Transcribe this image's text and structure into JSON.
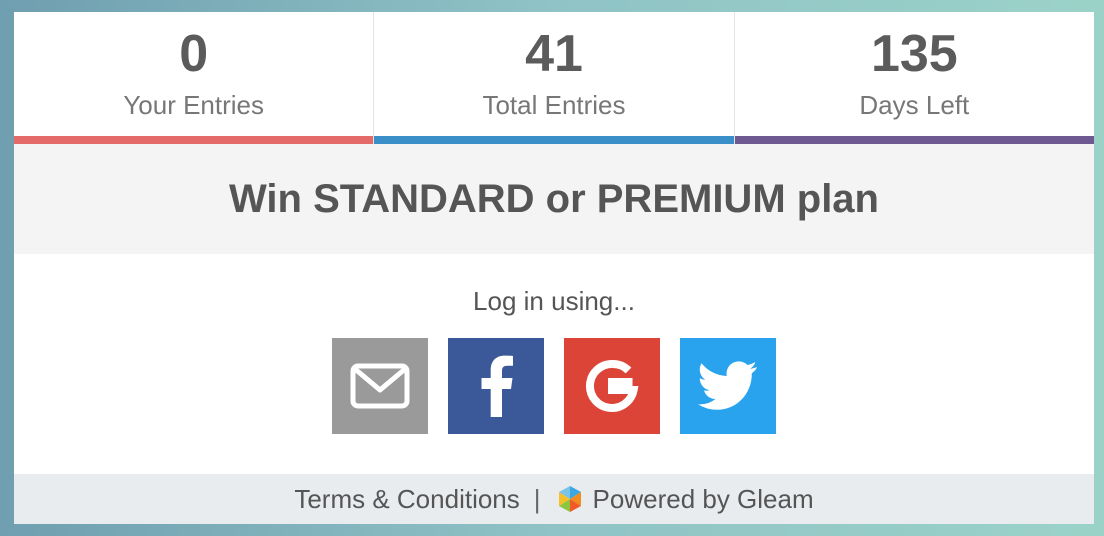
{
  "stats": [
    {
      "value": "0",
      "label": "Your Entries",
      "color": "#e46a6a"
    },
    {
      "value": "41",
      "label": "Total Entries",
      "color": "#3a8fc9"
    },
    {
      "value": "135",
      "label": "Days Left",
      "color": "#6e5a91"
    }
  ],
  "campaign": {
    "title": "Win STANDARD or PREMIUM plan"
  },
  "login": {
    "prompt": "Log in using...",
    "methods": [
      {
        "name": "email",
        "icon": "envelope-icon",
        "color": "#9a9a9a"
      },
      {
        "name": "facebook",
        "icon": "facebook-icon",
        "color": "#3b5998"
      },
      {
        "name": "google",
        "icon": "google-icon",
        "color": "#dc4437"
      },
      {
        "name": "twitter",
        "icon": "twitter-icon",
        "color": "#2aa3ef"
      }
    ]
  },
  "footer": {
    "terms": "Terms & Conditions",
    "separator": "|",
    "powered_by": "Powered by Gleam",
    "logo_icon": "gleam-logo-icon"
  }
}
